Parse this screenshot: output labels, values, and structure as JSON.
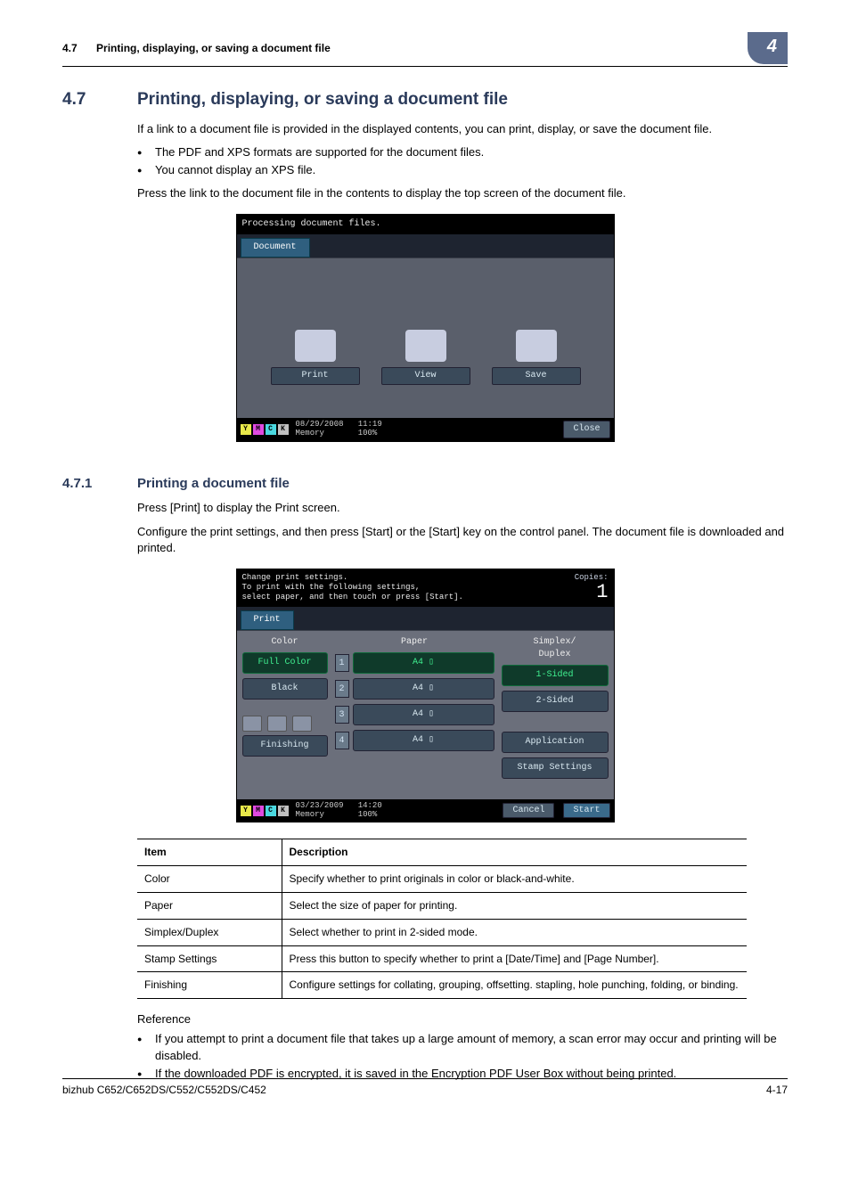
{
  "header": {
    "section_number": "4.7",
    "section_title_running": "Printing, displaying, or saving a document file",
    "chapter_badge": "4"
  },
  "section": {
    "number": "4.7",
    "title": "Printing, displaying, or saving a document file",
    "intro": "If a link to a document file is provided in the displayed contents, you can print, display, or save the document file.",
    "bullets": [
      "The PDF and XPS formats are supported for the document files.",
      "You cannot display an XPS file."
    ],
    "after_bullets": "Press the link to the document file in the contents to display the top screen of the document file."
  },
  "screen1": {
    "status": "Processing document files.",
    "tab": "Document",
    "buttons": {
      "print": "Print",
      "view": "View",
      "save": "Save"
    },
    "toner": {
      "y": "Y",
      "m": "M",
      "c": "C",
      "k": "K"
    },
    "footer": {
      "date": "08/29/2008",
      "time": "11:19",
      "mem_label": "Memory",
      "mem_value": "100%"
    },
    "close": "Close"
  },
  "subsection": {
    "number": "4.7.1",
    "title": "Printing a document file",
    "p1": "Press [Print] to display the Print screen.",
    "p2": "Configure the print settings, and then press [Start] or the [Start] key on the control panel. The document file is downloaded and printed."
  },
  "screen2": {
    "status_lines": "Change print settings.\nTo print with the following settings,\nselect paper, and then touch or press [Start].",
    "copies_label": "Copies:",
    "copies_value": "1",
    "tab": "Print",
    "columns": {
      "color": "Color",
      "paper": "Paper",
      "duplex": "Simplex/\nDuplex"
    },
    "color": {
      "full": "Full Color",
      "black": "Black"
    },
    "trays": [
      {
        "n": "1",
        "label": "A4 ▯"
      },
      {
        "n": "2",
        "label": "A4 ▯"
      },
      {
        "n": "3",
        "label": "A4 ▯"
      },
      {
        "n": "4",
        "label": "A4 ▯"
      }
    ],
    "duplex": {
      "one": "1-Sided",
      "two": "2-Sided"
    },
    "side": {
      "application": "Application",
      "stamp": "Stamp Settings"
    },
    "finishing": "Finishing",
    "footer": {
      "date": "03/23/2009",
      "time": "14:20",
      "mem_label": "Memory",
      "mem_value": "100%"
    },
    "cancel": "Cancel",
    "start": "Start"
  },
  "table": {
    "head": {
      "item": "Item",
      "desc": "Description"
    },
    "rows": [
      {
        "item": "Color",
        "desc": "Specify whether to print originals in color or black-and-white."
      },
      {
        "item": "Paper",
        "desc": "Select the size of paper for printing."
      },
      {
        "item": "Simplex/Duplex",
        "desc": "Select whether to print in 2-sided mode."
      },
      {
        "item": "Stamp Settings",
        "desc": "Press this button to specify whether to print a [Date/Time] and [Page Number]."
      },
      {
        "item": "Finishing",
        "desc": "Configure settings for collating, grouping, offsetting. stapling, hole punching, folding, or binding."
      }
    ]
  },
  "reference": {
    "heading": "Reference",
    "bullets": [
      "If you attempt to print a document file that takes up a large amount of memory, a scan error may occur and printing will be disabled.",
      "If the downloaded PDF is encrypted, it is saved in the Encryption PDF User Box without being printed."
    ]
  },
  "footer": {
    "model": "bizhub C652/C652DS/C552/C552DS/C452",
    "page": "4-17"
  }
}
